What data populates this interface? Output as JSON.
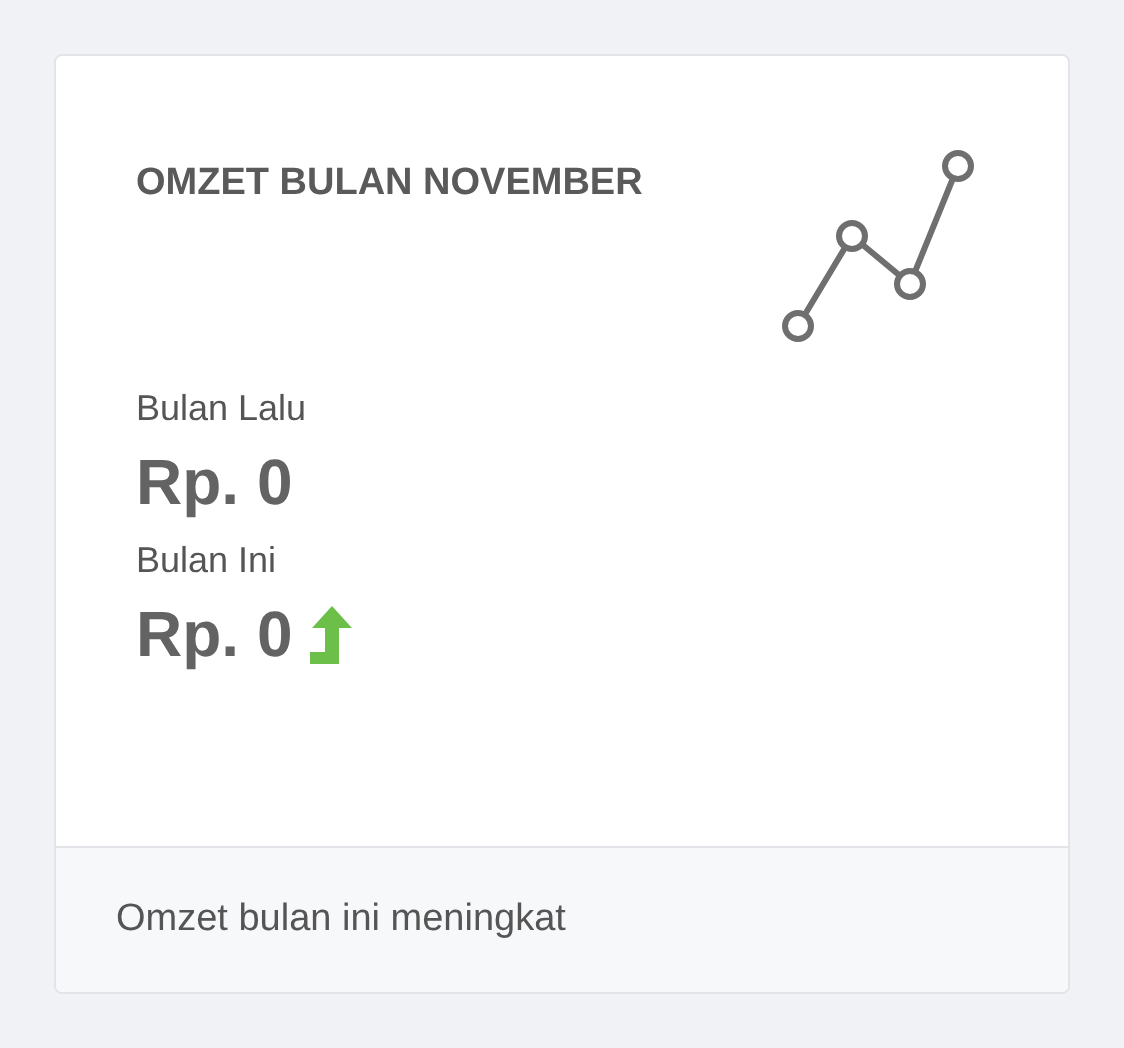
{
  "card": {
    "title": "OMZET BULAN NOVEMBER",
    "items": [
      {
        "label": "Bulan Lalu",
        "value": "Rp. 0",
        "rising": false
      },
      {
        "label": "Bulan Ini",
        "value": "Rp. 0",
        "rising": true
      }
    ],
    "footer": "Omzet bulan ini meningkat"
  }
}
